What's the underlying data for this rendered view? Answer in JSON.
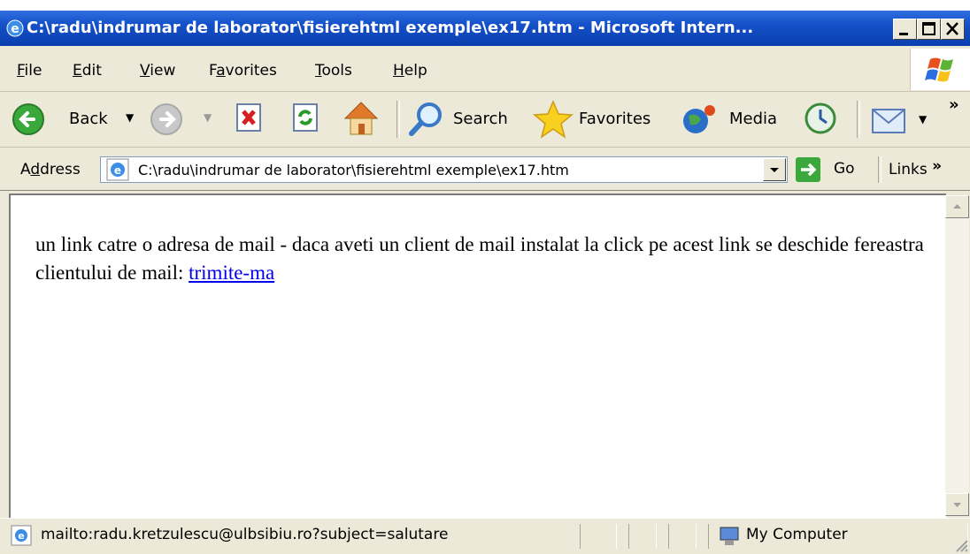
{
  "window": {
    "title": "C:\\radu\\indrumar de laborator\\fisierehtml exemple\\ex17.htm - Microsoft Intern..."
  },
  "menu": {
    "items": [
      {
        "pre": "",
        "u": "F",
        "post": "ile"
      },
      {
        "pre": "",
        "u": "E",
        "post": "dit"
      },
      {
        "pre": "",
        "u": "V",
        "post": "iew"
      },
      {
        "pre": "F",
        "u": "a",
        "post": "vorites"
      },
      {
        "pre": "",
        "u": "T",
        "post": "ools"
      },
      {
        "pre": "",
        "u": "H",
        "post": "elp"
      }
    ]
  },
  "toolbar": {
    "back_label": "Back",
    "search_label": "Search",
    "favorites_label": "Favorites",
    "media_label": "Media",
    "chevron": "»"
  },
  "address": {
    "label_pre": "A",
    "label_u": "d",
    "label_post": "dress",
    "url": "C:\\radu\\indrumar de laborator\\fisierehtml exemple\\ex17.htm",
    "go_label": "Go",
    "links_label": "Links",
    "chevron": "»"
  },
  "content": {
    "text": "un link catre o adresa de mail - daca aveti un client de mail instalat la click pe acest link se deschide fereastra clientului de mail:",
    "link_text": "trimite-ma"
  },
  "status": {
    "text": "mailto:radu.kretzulescu@ulbsibiu.ro?subject=salutare",
    "zone": "My Computer"
  }
}
